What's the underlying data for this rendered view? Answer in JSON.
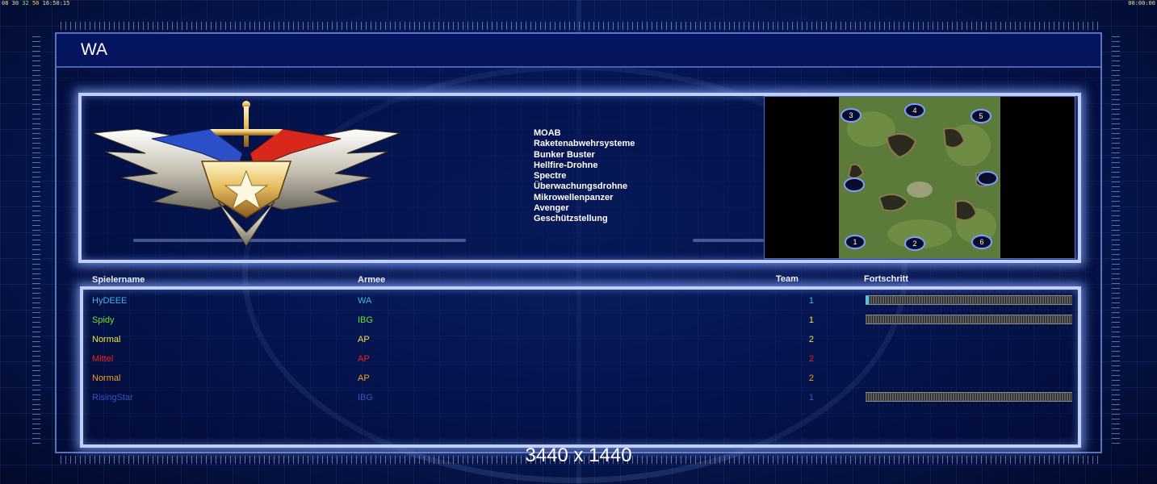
{
  "clock": {
    "left_a": "08",
    "left_b": "30",
    "left_c": "32",
    "left_d": "50",
    "left_time": "16:50:15",
    "right_time": "00:00:00"
  },
  "army": {
    "title": "WA"
  },
  "powers": [
    "MOAB",
    "Raketenabwehrsysteme",
    "Bunker Buster",
    "Hellfire-Drohne",
    "Spectre",
    "Überwachungsdrohne",
    "Mikrowellenpanzer",
    "Avenger",
    "Geschützstellung"
  ],
  "minimap": {
    "start_labels": [
      "1",
      "2",
      "3",
      "4",
      "5",
      "6"
    ]
  },
  "table": {
    "headers": {
      "name": "Spielername",
      "army": "Armee",
      "team": "Team",
      "progress": "Fortschritt"
    },
    "rows": [
      {
        "name": "HyDEEE",
        "army": "WA",
        "team": "1",
        "color": "#3fb6e8",
        "progress": 0.01
      },
      {
        "name": "Spidy",
        "army": "IBG",
        "team": "1",
        "color": "#6fe03a",
        "progress": 0
      },
      {
        "name": "Normal",
        "army": "AP",
        "team": "2",
        "color": "#f2e23a"
      },
      {
        "name": "Mittel",
        "army": "AP",
        "team": "2",
        "color": "#e8231e"
      },
      {
        "name": "Normal",
        "army": "AP",
        "team": "2",
        "color": "#f0a020"
      },
      {
        "name": "RisingStar",
        "army": "IBG",
        "team": "1",
        "color": "#3c50c8",
        "progress": 0
      }
    ]
  },
  "resolution": "3440 x 1440"
}
